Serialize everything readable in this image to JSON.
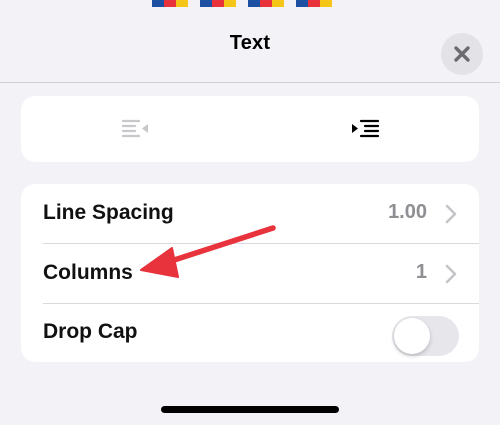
{
  "header": {
    "title": "Text"
  },
  "alignment": {
    "options": [
      {
        "name": "indent-left",
        "icon": "decrease-indent-icon",
        "selected": false
      },
      {
        "name": "indent-right",
        "icon": "increase-indent-icon",
        "selected": true
      }
    ]
  },
  "settings": {
    "line_spacing": {
      "label": "Line Spacing",
      "value": "1.00"
    },
    "columns": {
      "label": "Columns",
      "value": "1"
    },
    "drop_cap": {
      "label": "Drop Cap",
      "enabled": false
    }
  },
  "colors": {
    "background": "#f2f2f7",
    "card": "#ffffff",
    "annotation_arrow": "#e8323c",
    "secondary_text": "#8e8e93"
  }
}
